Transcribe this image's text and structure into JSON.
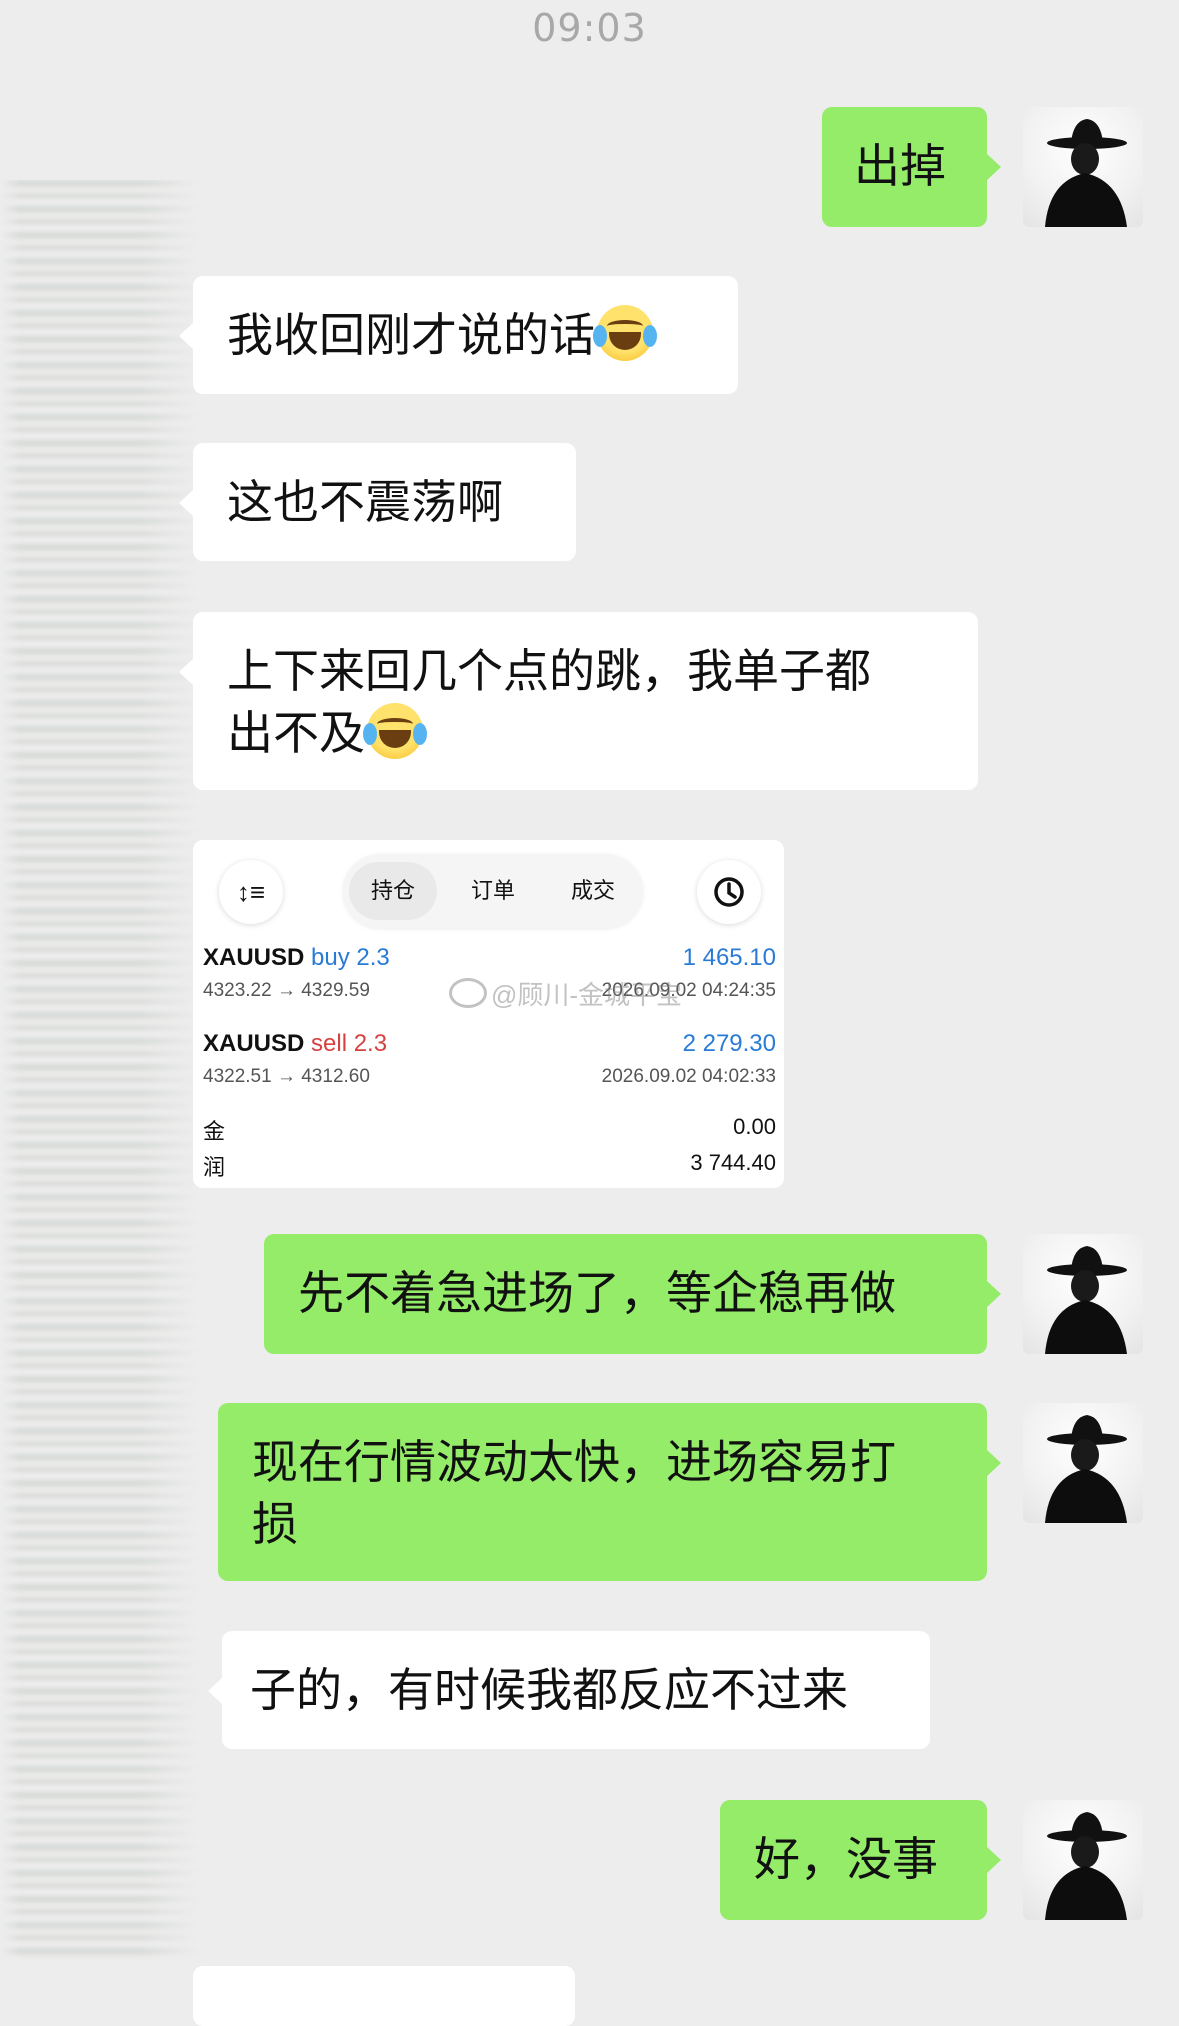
{
  "status_time": "09:03",
  "messages": {
    "m1": "出掉",
    "m2": "我收回刚才说的话",
    "m3": "这也不震荡啊",
    "m4_line1": "上下来回几个点的跳，我单子都",
    "m4_line2": "出不及",
    "m6": "先不着急进场了，等企稳再做",
    "m7_line1": "现在行情波动太快，进场容易打",
    "m7_line2": "损",
    "m8": "子的，有时候我都反应不过来",
    "m9": "好，没事"
  },
  "emoji": "face-with-tears-of-joy",
  "screenshot": {
    "tabs": [
      "持仓",
      "订单",
      "成交"
    ],
    "active_tab": "持仓",
    "positions": [
      {
        "symbol": "XAUUSD",
        "side": "buy 2.3",
        "profit": "1 465.10",
        "prices": "4323.22 → 4329.59",
        "time": "2026.09.02 04:24:35"
      },
      {
        "symbol": "XAUUSD",
        "side": "sell 2.3",
        "profit": "2 279.30",
        "prices": "4322.51 → 4312.60",
        "time": "2026.09.02 04:02:33"
      }
    ],
    "summary": [
      {
        "label": "金",
        "value": "0.00"
      },
      {
        "label": "润",
        "value": "3 744.40"
      }
    ],
    "watermark": "@顾川-金城平宝"
  }
}
